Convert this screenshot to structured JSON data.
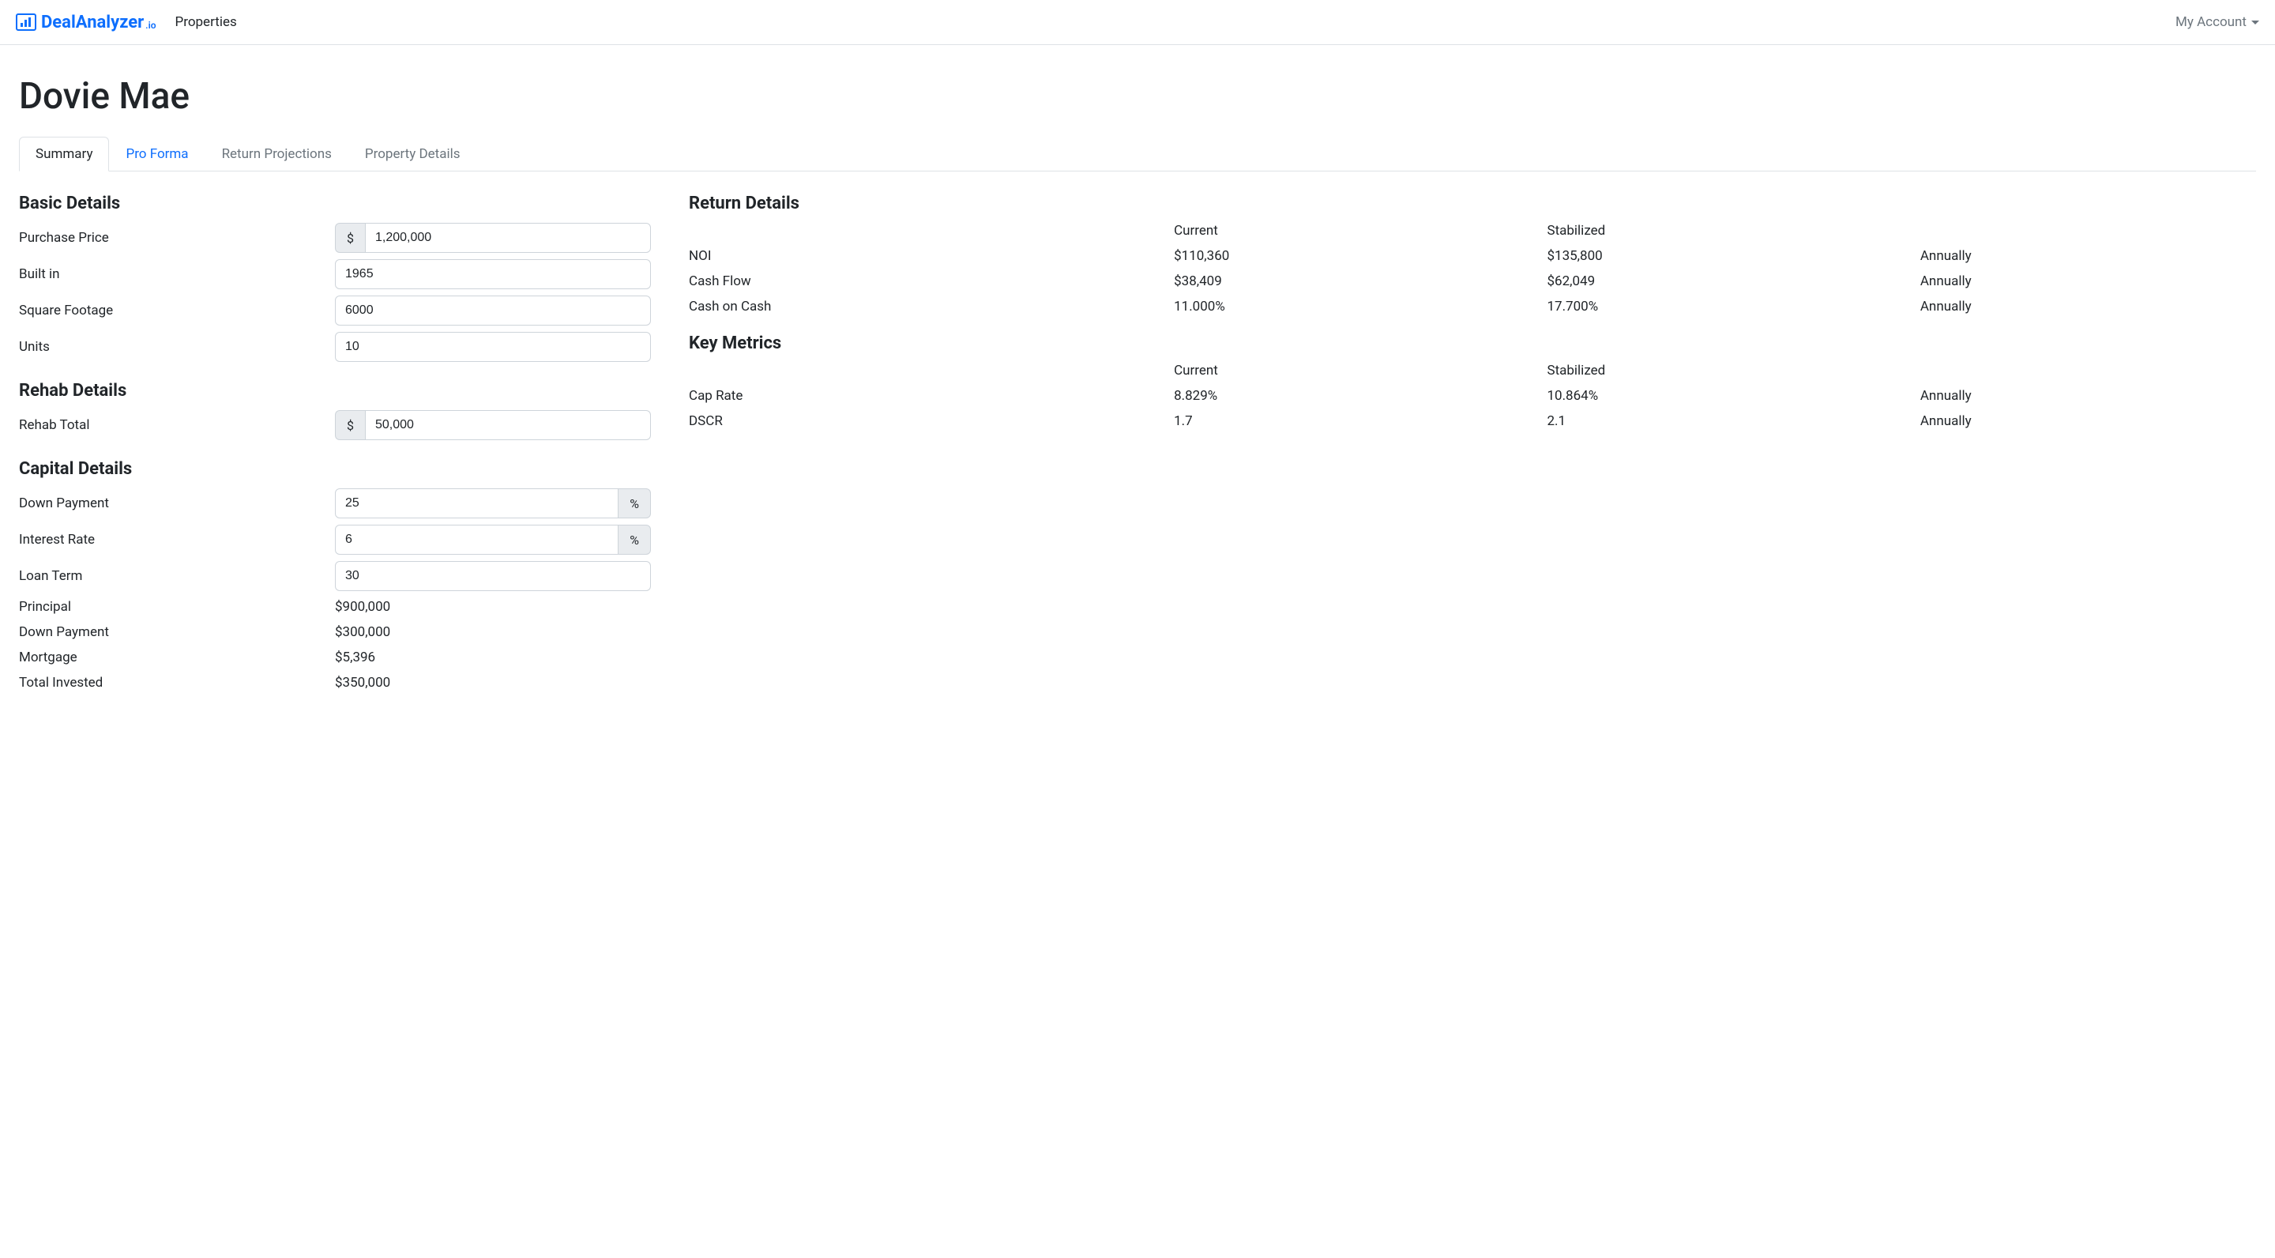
{
  "navbar": {
    "brand_main": "DealAnalyzer",
    "brand_suffix": ".io",
    "properties_label": "Properties",
    "account_label": "My Account"
  },
  "page": {
    "title": "Dovie Mae"
  },
  "tabs": [
    {
      "key": "summary",
      "label": "Summary",
      "active": true,
      "link": false
    },
    {
      "key": "proforma",
      "label": "Pro Forma",
      "active": false,
      "link": true
    },
    {
      "key": "returns",
      "label": "Return Projections",
      "active": false,
      "link": false
    },
    {
      "key": "details",
      "label": "Property Details",
      "active": false,
      "link": false
    }
  ],
  "basic_details": {
    "heading": "Basic Details",
    "purchase_price": {
      "label": "Purchase Price",
      "value": "1,200,000",
      "prefix": "$"
    },
    "built_in": {
      "label": "Built in",
      "value": "1965"
    },
    "square_footage": {
      "label": "Square Footage",
      "value": "6000"
    },
    "units": {
      "label": "Units",
      "value": "10"
    }
  },
  "rehab_details": {
    "heading": "Rehab Details",
    "rehab_total": {
      "label": "Rehab Total",
      "value": "50,000",
      "prefix": "$"
    }
  },
  "capital_details": {
    "heading": "Capital Details",
    "down_payment_pct": {
      "label": "Down Payment",
      "value": "25",
      "suffix": "%"
    },
    "interest_rate": {
      "label": "Interest Rate",
      "value": "6",
      "suffix": "%"
    },
    "loan_term": {
      "label": "Loan Term",
      "value": "30"
    },
    "principal": {
      "label": "Principal",
      "value": "$900,000"
    },
    "down_payment_amt": {
      "label": "Down Payment",
      "value": "$300,000"
    },
    "mortgage": {
      "label": "Mortgage",
      "value": "$5,396"
    },
    "total_invested": {
      "label": "Total Invested",
      "value": "$350,000"
    }
  },
  "return_details": {
    "heading": "Return Details",
    "col_current": "Current",
    "col_stabilized": "Stabilized",
    "rows": [
      {
        "label": "NOI",
        "current": "$110,360",
        "stabilized": "$135,800",
        "period": "Annually"
      },
      {
        "label": "Cash Flow",
        "current": "$38,409",
        "stabilized": "$62,049",
        "period": "Annually"
      },
      {
        "label": "Cash on Cash",
        "current": "11.000%",
        "stabilized": "17.700%",
        "period": "Annually"
      }
    ]
  },
  "key_metrics": {
    "heading": "Key Metrics",
    "col_current": "Current",
    "col_stabilized": "Stabilized",
    "rows": [
      {
        "label": "Cap Rate",
        "current": "8.829%",
        "stabilized": "10.864%",
        "period": "Annually"
      },
      {
        "label": "DSCR",
        "current": "1.7",
        "stabilized": "2.1",
        "period": "Annually"
      }
    ]
  }
}
